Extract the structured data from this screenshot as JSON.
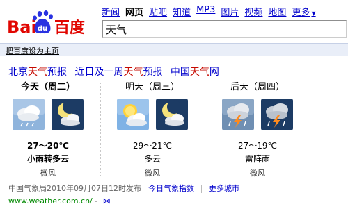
{
  "nav": {
    "items": [
      {
        "label": "新闻",
        "current": false
      },
      {
        "label": "网页",
        "current": true
      },
      {
        "label": "贴吧",
        "current": false
      },
      {
        "label": "知道",
        "current": false
      },
      {
        "label": "MP3",
        "current": false
      },
      {
        "label": "图片",
        "current": false
      },
      {
        "label": "视频",
        "current": false
      },
      {
        "label": "地图",
        "current": false
      }
    ],
    "more_label": "更多",
    "more_arrow": "▼"
  },
  "logo": {
    "text_left": "Bai",
    "text_paw": "du",
    "text_right": "百度"
  },
  "search": {
    "value": "天气"
  },
  "bar": {
    "homepage_link": "把百度设为主页"
  },
  "result": {
    "title_parts": [
      {
        "pre": "北京",
        "hl": "天气",
        "post": "预报"
      },
      {
        "pre": "近日及一周",
        "hl": "天气",
        "post": "预报"
      },
      {
        "pre": "中国",
        "hl": "天气",
        "post": "网"
      }
    ],
    "days": [
      {
        "name": "今天（周二）",
        "icons": [
          "cloud-rain-icon",
          "moon-cloud-icon"
        ],
        "temp": "27～20℃",
        "condition": "小雨转多云",
        "wind": "微风"
      },
      {
        "name": "明天（周三）",
        "icons": [
          "sun-cloud-icon",
          "moon-cloud-icon"
        ],
        "temp": "29～21℃",
        "condition": "多云",
        "wind": "微风"
      },
      {
        "name": "后天（周四）",
        "icons": [
          "thunder-rain-icon",
          "thunder-rain-night-icon"
        ],
        "temp": "27～19℃",
        "condition": "雷阵雨",
        "wind": "微风"
      }
    ],
    "footer_source": "中国气象局2010年09月07日12时发布",
    "footer_link1": "今日气象指数",
    "footer_link2": "更多城市",
    "url": "www.weather.com.cn/",
    "url_dash": "-",
    "snapshot_label": "⋈"
  },
  "colors": {
    "link": "#0000cc",
    "highlight": "#c60a00",
    "url": "#008000",
    "bar": "#e9eef8"
  }
}
